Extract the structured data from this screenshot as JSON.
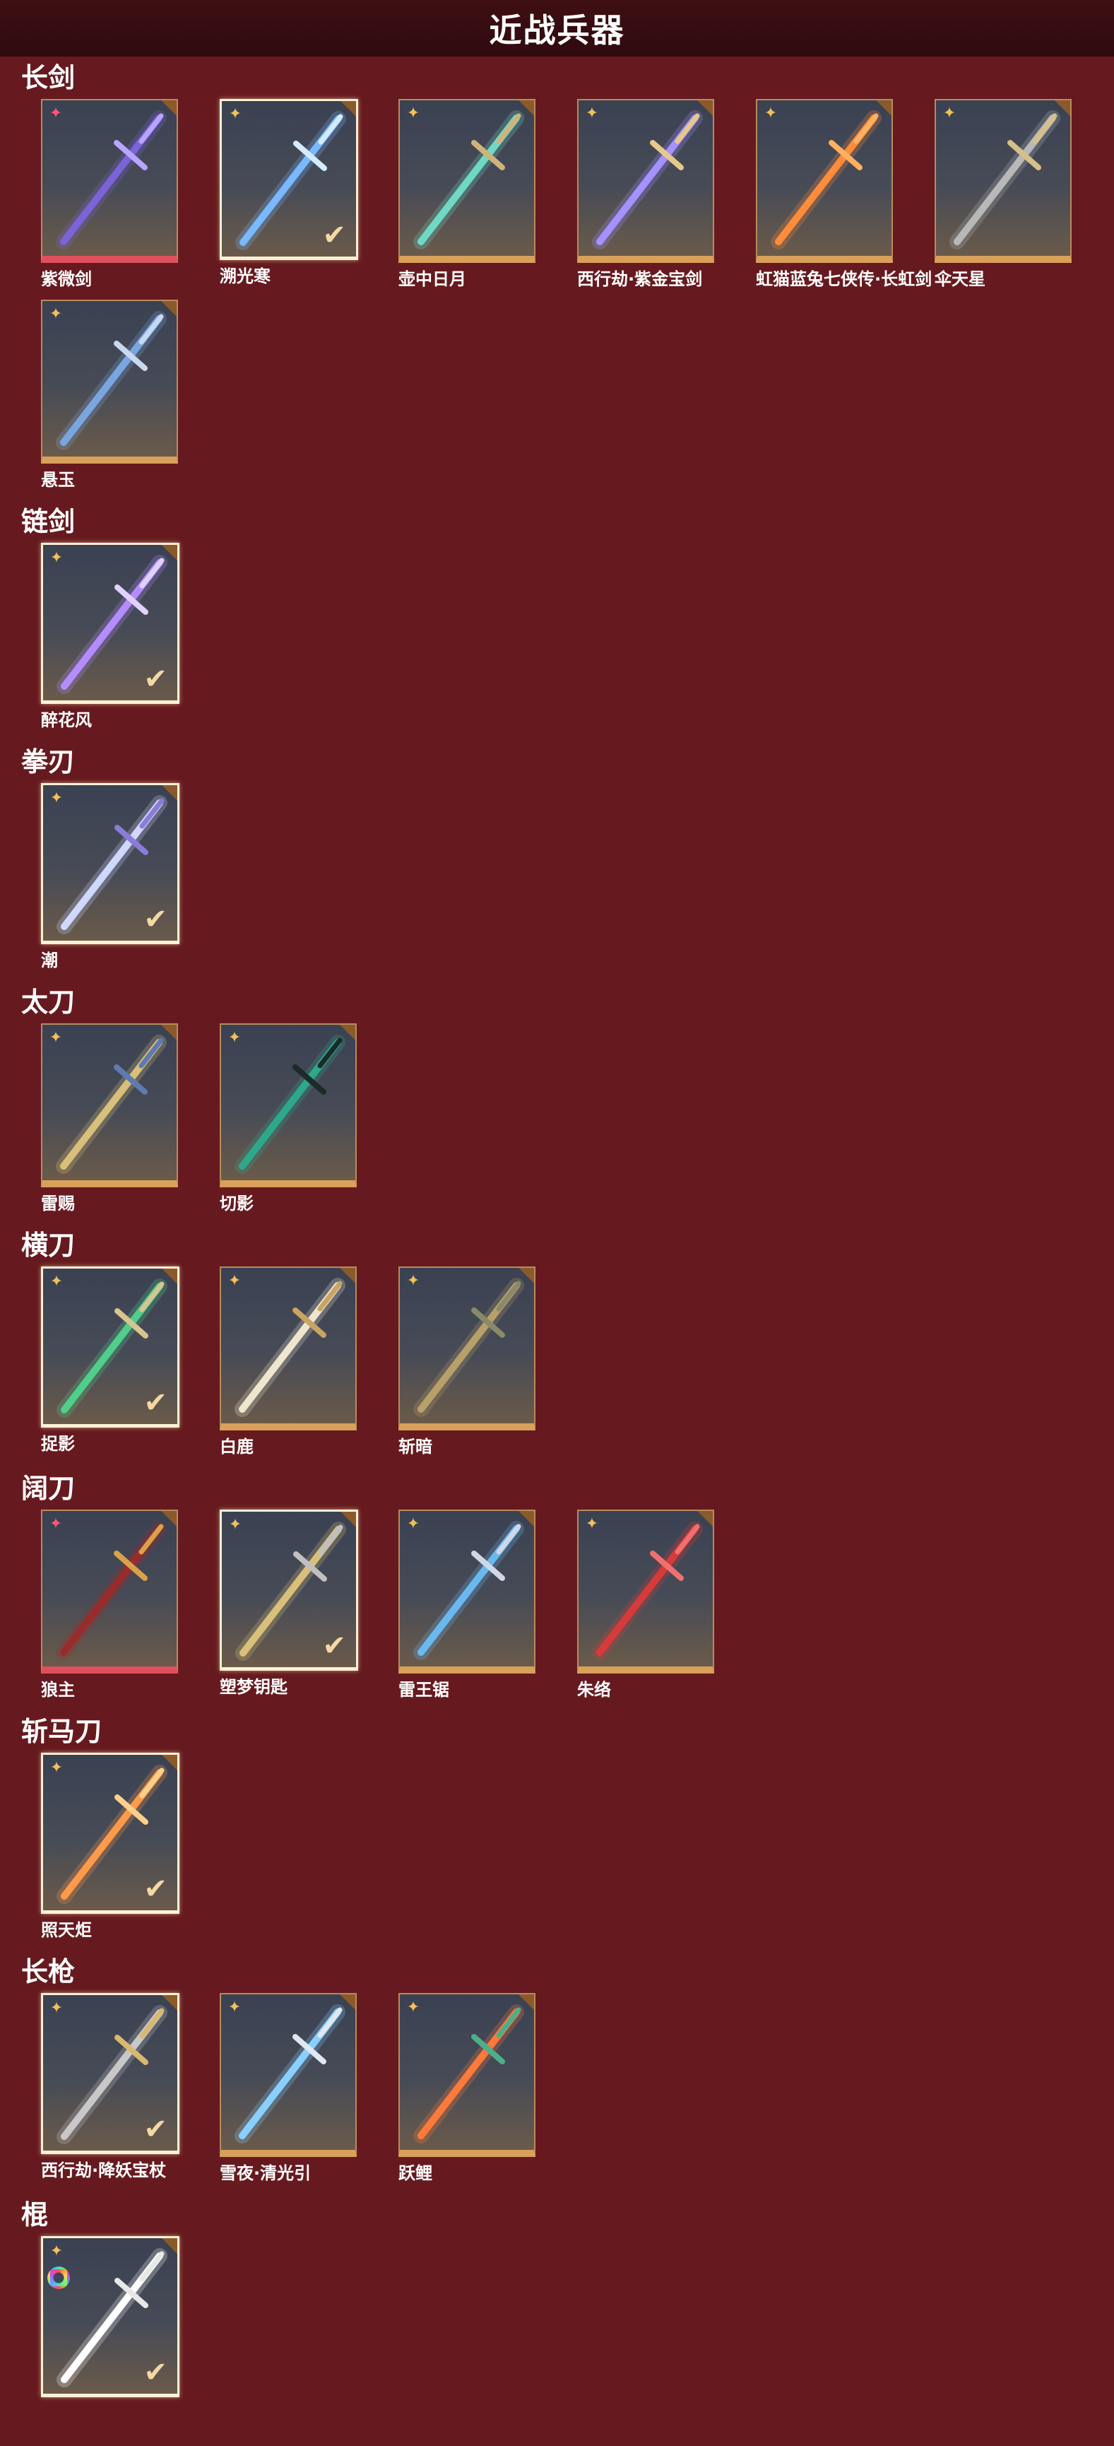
{
  "header": {
    "title": "近战兵器"
  },
  "sections": [
    {
      "title": "长剑",
      "items": [
        {
          "name": "紫微剑",
          "badge": "pink",
          "owned": false,
          "rare": "red",
          "blade": "#7b63d8",
          "hilt": "#b9a4ff"
        },
        {
          "name": "溯光寒",
          "badge": "gold",
          "owned": true,
          "rare": "",
          "blade": "#7ab8ff",
          "hilt": "#d4ecff"
        },
        {
          "name": "壶中日月",
          "badge": "gold",
          "owned": false,
          "rare": "",
          "blade": "#6fd9c4",
          "hilt": "#d0b37a"
        },
        {
          "name": "西行劫·紫金宝剑",
          "badge": "gold",
          "owned": false,
          "rare": "",
          "blade": "#a591ff",
          "hilt": "#e6c98a"
        },
        {
          "name": "虹猫蓝兔七侠传·长虹剑",
          "badge": "gold",
          "owned": false,
          "rare": "",
          "blade": "#ff8c3a",
          "hilt": "#ffb060"
        },
        {
          "name": "伞天星",
          "badge": "gold",
          "owned": false,
          "rare": "",
          "blade": "#b8b8b8",
          "hilt": "#d6c08a"
        },
        {
          "name": "悬玉",
          "badge": "gold",
          "owned": false,
          "rare": "",
          "blade": "#7aa6e0",
          "hilt": "#c8d8f0"
        }
      ]
    },
    {
      "title": "链剑",
      "items": [
        {
          "name": "醉花风",
          "badge": "gold",
          "owned": true,
          "rare": "",
          "blade": "#b58cff",
          "hilt": "#e0d2ff"
        }
      ]
    },
    {
      "title": "拳刃",
      "items": [
        {
          "name": "潮",
          "badge": "gold",
          "owned": true,
          "rare": "",
          "blade": "#cfd8ff",
          "hilt": "#8a7cd8"
        }
      ]
    },
    {
      "title": "太刀",
      "items": [
        {
          "name": "雷赐",
          "badge": "gold",
          "owned": false,
          "rare": "",
          "blade": "#d8c07a",
          "hilt": "#5f7ab0"
        },
        {
          "name": "切影",
          "badge": "gold",
          "owned": false,
          "rare": "",
          "blade": "#2ea88a",
          "hilt": "#1c2a28"
        }
      ]
    },
    {
      "title": "横刀",
      "items": [
        {
          "name": "捉影",
          "badge": "gold",
          "owned": true,
          "rare": "",
          "blade": "#4fcf8a",
          "hilt": "#d7c48f"
        },
        {
          "name": "白鹿",
          "badge": "gold",
          "owned": false,
          "rare": "",
          "blade": "#efe6cf",
          "hilt": "#c9a463"
        },
        {
          "name": "斩暗",
          "badge": "gold",
          "owned": false,
          "rare": "",
          "blade": "#b8a06a",
          "hilt": "#8a8a6a"
        }
      ]
    },
    {
      "title": "阔刀",
      "items": [
        {
          "name": "狼主",
          "badge": "pink",
          "owned": false,
          "rare": "red",
          "blade": "#9a2b2b",
          "hilt": "#d8a24a"
        },
        {
          "name": "塑梦钥匙",
          "badge": "gold",
          "owned": true,
          "rare": "",
          "blade": "#d9c07a",
          "hilt": "#c0c0c0"
        },
        {
          "name": "雷王锯",
          "badge": "gold",
          "owned": false,
          "rare": "",
          "blade": "#6ab8f0",
          "hilt": "#d0d8e8"
        },
        {
          "name": "朱络",
          "badge": "gold",
          "owned": false,
          "rare": "",
          "blade": "#d83a3a",
          "hilt": "#f07070"
        }
      ]
    },
    {
      "title": "斩马刀",
      "items": [
        {
          "name": "照天炬",
          "badge": "gold",
          "owned": true,
          "rare": "",
          "blade": "#ff9a4a",
          "hilt": "#ffd08a"
        }
      ]
    },
    {
      "title": "长枪",
      "items": [
        {
          "name": "西行劫·降妖宝杖",
          "badge": "gold",
          "owned": true,
          "rare": "",
          "blade": "#c8c8c8",
          "hilt": "#d8b870"
        },
        {
          "name": "雪夜·清光引",
          "badge": "gold",
          "owned": false,
          "rare": "",
          "blade": "#8ad0ff",
          "hilt": "#e0e8f0"
        },
        {
          "name": "跃鲤",
          "badge": "gold",
          "owned": false,
          "rare": "",
          "blade": "#ff7a3a",
          "hilt": "#4fae8a"
        }
      ]
    },
    {
      "title": "棍",
      "items": [
        {
          "name": "",
          "badge": "gold",
          "owned": true,
          "rare": "",
          "ring": true,
          "blade": "#ffffff",
          "hilt": "#e8e8e8"
        }
      ]
    }
  ],
  "icons": {
    "badge": "star-badge-icon",
    "owned": "checkmark-icon",
    "ring": "rainbow-ring-icon"
  },
  "colors": {
    "background": "#661a1f",
    "header": "#3f0f13",
    "gold_border": "#d9a05a",
    "red_border": "#e0505c"
  }
}
